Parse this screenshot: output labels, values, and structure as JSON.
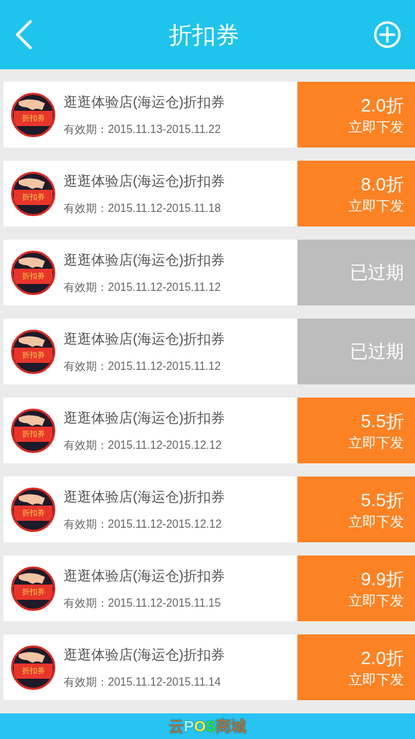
{
  "header": {
    "title": "折扣券"
  },
  "coupons": [
    {
      "badge": "折扣券",
      "title": "逛逛体验店(海运仓)折扣券",
      "validity": "有效期：2015.11.13-2015.11.22",
      "kind": "active",
      "discount": "2.0折",
      "action": "立即下发"
    },
    {
      "badge": "折扣券",
      "title": "逛逛体验店(海运仓)折扣券",
      "validity": "有效期：2015.11.12-2015.11.18",
      "kind": "active",
      "discount": "8.0折",
      "action": "立即下发"
    },
    {
      "badge": "折扣券",
      "title": "逛逛体验店(海运仓)折扣券",
      "validity": "有效期：2015.11.12-2015.11.12",
      "kind": "expired",
      "status": "已过期"
    },
    {
      "badge": "折扣券",
      "title": "逛逛体验店(海运仓)折扣券",
      "validity": "有效期：2015.11.12-2015.11.12",
      "kind": "expired",
      "status": "已过期"
    },
    {
      "badge": "折扣券",
      "title": "逛逛体验店(海运仓)折扣券",
      "validity": "有效期：2015.11.12-2015.12.12",
      "kind": "active",
      "discount": "5.5折",
      "action": "立即下发"
    },
    {
      "badge": "折扣券",
      "title": "逛逛体验店(海运仓)折扣券",
      "validity": "有效期：2015.11.12-2015.12.12",
      "kind": "active",
      "discount": "5.5折",
      "action": "立即下发"
    },
    {
      "badge": "折扣券",
      "title": "逛逛体验店(海运仓)折扣券",
      "validity": "有效期：2015.11.12-2015.11.15",
      "kind": "active",
      "discount": "9.9折",
      "action": "立即下发"
    },
    {
      "badge": "折扣券",
      "title": "逛逛体验店(海运仓)折扣券",
      "validity": "有效期：2015.11.12-2015.11.14",
      "kind": "active",
      "discount": "2.0折",
      "action": "立即下发"
    }
  ],
  "footer_logo": [
    {
      "text": "云",
      "color": "#a8753c"
    },
    {
      "text": "P",
      "color": "#9ff6ff"
    },
    {
      "text": "O",
      "color": "#f2f22a"
    },
    {
      "text": "S",
      "color": "#2ee82e"
    },
    {
      "text": "商城",
      "color": "#a8753c"
    }
  ]
}
